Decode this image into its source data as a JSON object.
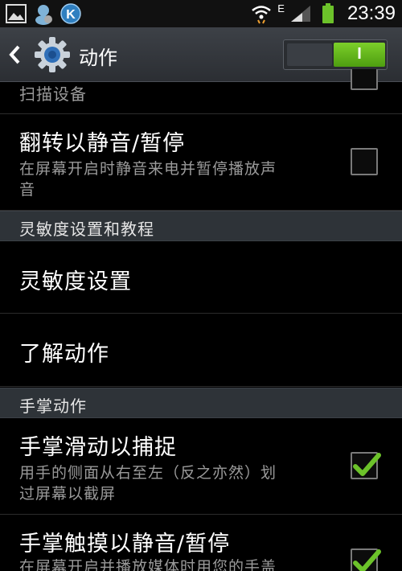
{
  "status_bar": {
    "time": "23:39",
    "network": "E",
    "icons": [
      "gallery-icon",
      "messenger-icon",
      "k-app-icon",
      "wifi-icon",
      "signal-icon",
      "battery-icon"
    ]
  },
  "action_bar": {
    "title": "动作",
    "toggle_on_label": "I",
    "toggle_state": "on"
  },
  "rows": [
    {
      "sub": "扫描设备",
      "checked": false
    },
    {
      "title": "翻转以静音/暂停",
      "sub_line1": "在屏幕开启时静音来电并暂停播放声",
      "sub_line2": "音",
      "checked": false
    },
    {
      "title": "灵敏度设置"
    },
    {
      "title": "了解动作"
    },
    {
      "title": "手掌滑动以捕捉",
      "sub_line1": "用手的侧面从右至左（反之亦然）划",
      "sub_line2": "过屏幕以截屏",
      "checked": true
    },
    {
      "title": "手掌触摸以静音/暂停",
      "sub_line1": "在屏幕开启并播放媒体时用您的手盖",
      "checked": true
    }
  ],
  "sections": [
    {
      "label": "灵敏度设置和教程"
    },
    {
      "label": "手掌动作"
    }
  ],
  "colors": {
    "accent_green": "#6cc22a",
    "section_bg": "#2e3338",
    "subtext": "#9a9a9a"
  }
}
